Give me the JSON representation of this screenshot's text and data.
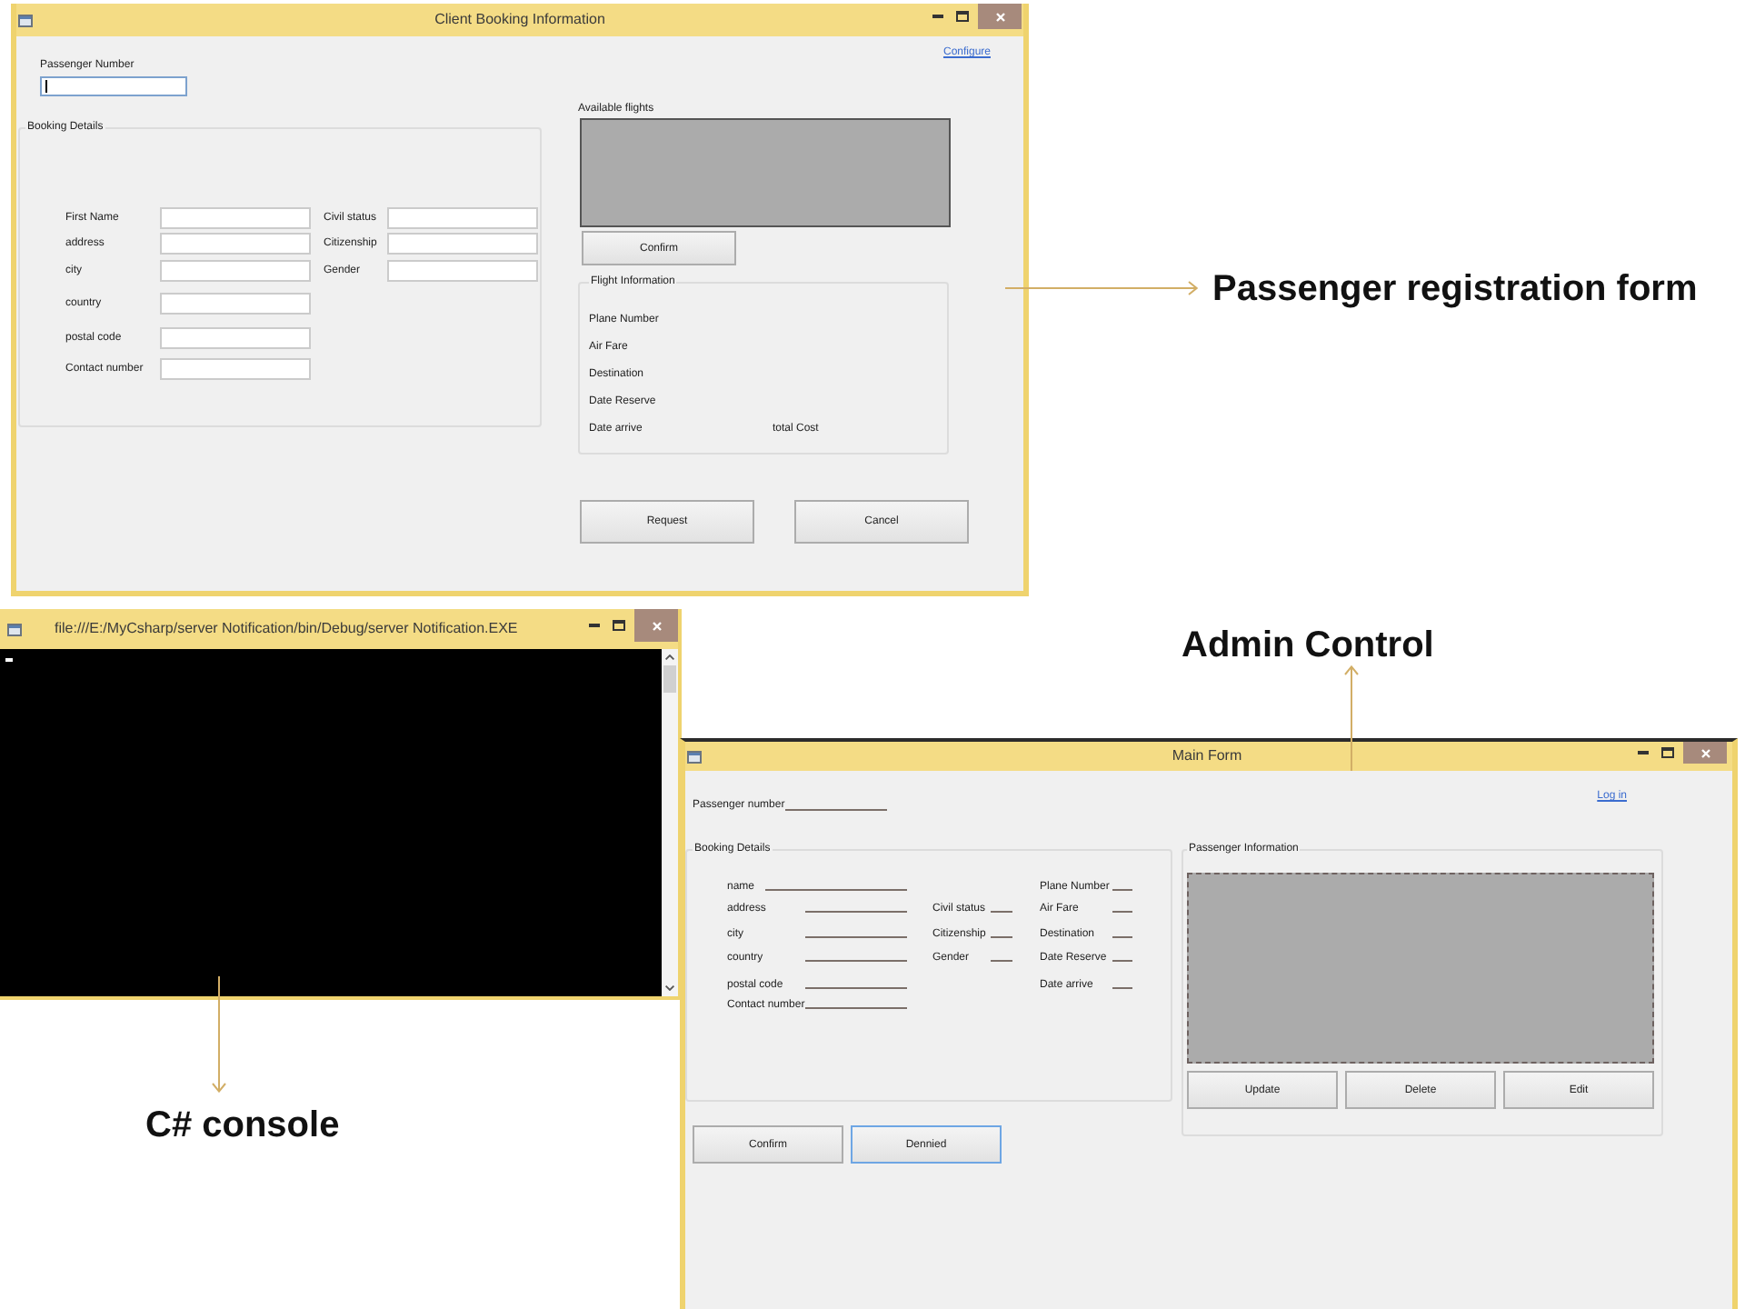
{
  "booking_window": {
    "title": "Client Booking Information",
    "link": "Configure",
    "passenger_number": {
      "label": "Passenger Number",
      "focused": true
    },
    "booking_details": {
      "title": "Booking Details",
      "column_1": [
        "First Name",
        "address",
        "city",
        "country",
        "postal code",
        "Contact number"
      ],
      "column_2": [
        "Civil status",
        "Citizenship",
        "Gender"
      ]
    },
    "available_flights": {
      "title": "Available flights"
    },
    "confirm_button": "Confirm",
    "flight_information": {
      "title": "Flight Information",
      "items": [
        "Plane Number",
        "Air Fare",
        "Destination",
        "Date Reserve",
        "Date arrive"
      ],
      "total_label": "total Cost"
    },
    "buttons": [
      "Request",
      "Cancel"
    ]
  },
  "console_window": {
    "title": "file:///E:/MyCsharp/server Notification/bin/Debug/server Notification.EXE"
  },
  "main_window": {
    "title": "Main Form",
    "link": "Log in",
    "passenger_number_label": "Passenger number",
    "booking_details": {
      "title": "Booking Details",
      "column_1": [
        "name",
        "address",
        "city",
        "country",
        "postal code",
        "Contact number"
      ],
      "column_2": [
        "Civil status",
        "Citizenship",
        "Gender"
      ],
      "column_3": [
        "Plane Number",
        "Air Fare",
        "Destination",
        "Date Reserve",
        "Date arrive"
      ]
    },
    "buttons": [
      {
        "label": "Confirm",
        "focused": false
      },
      {
        "label": "Dennied",
        "focused": true
      }
    ],
    "passenger_information": {
      "title": "Passenger Information",
      "buttons": [
        "Update",
        "Delete",
        "Edit"
      ]
    }
  },
  "callouts": [
    {
      "label": "Passenger registration form"
    },
    {
      "label": "Admin Control"
    },
    {
      "label": "C# console"
    }
  ]
}
